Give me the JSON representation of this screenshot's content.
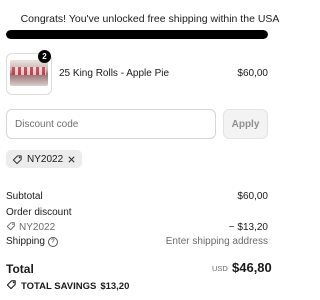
{
  "banner": {
    "message": "Congrats! You've unlocked free shipping within the USA",
    "progress_percent": 100
  },
  "cart": {
    "items": [
      {
        "quantity": "2",
        "name": "25 King Rolls - Apple Pie",
        "price": "$60,00"
      }
    ]
  },
  "discount": {
    "placeholder": "Discount code",
    "apply_label": "Apply",
    "applied_code": "NY2022"
  },
  "summary": {
    "subtotal_label": "Subtotal",
    "subtotal_value": "$60,00",
    "order_discount_label": "Order discount",
    "discount_code": "NY2022",
    "discount_value": "− $13,20",
    "shipping_label": "Shipping",
    "shipping_help": "?",
    "shipping_value": "Enter shipping address",
    "total_label": "Total",
    "currency": "USD",
    "total_value": "$46,80",
    "savings_label": "TOTAL SAVINGS",
    "savings_value": "$13,20"
  },
  "icons": {
    "tag": "tag-icon",
    "remove": "close-icon",
    "help": "help-circle-icon"
  }
}
